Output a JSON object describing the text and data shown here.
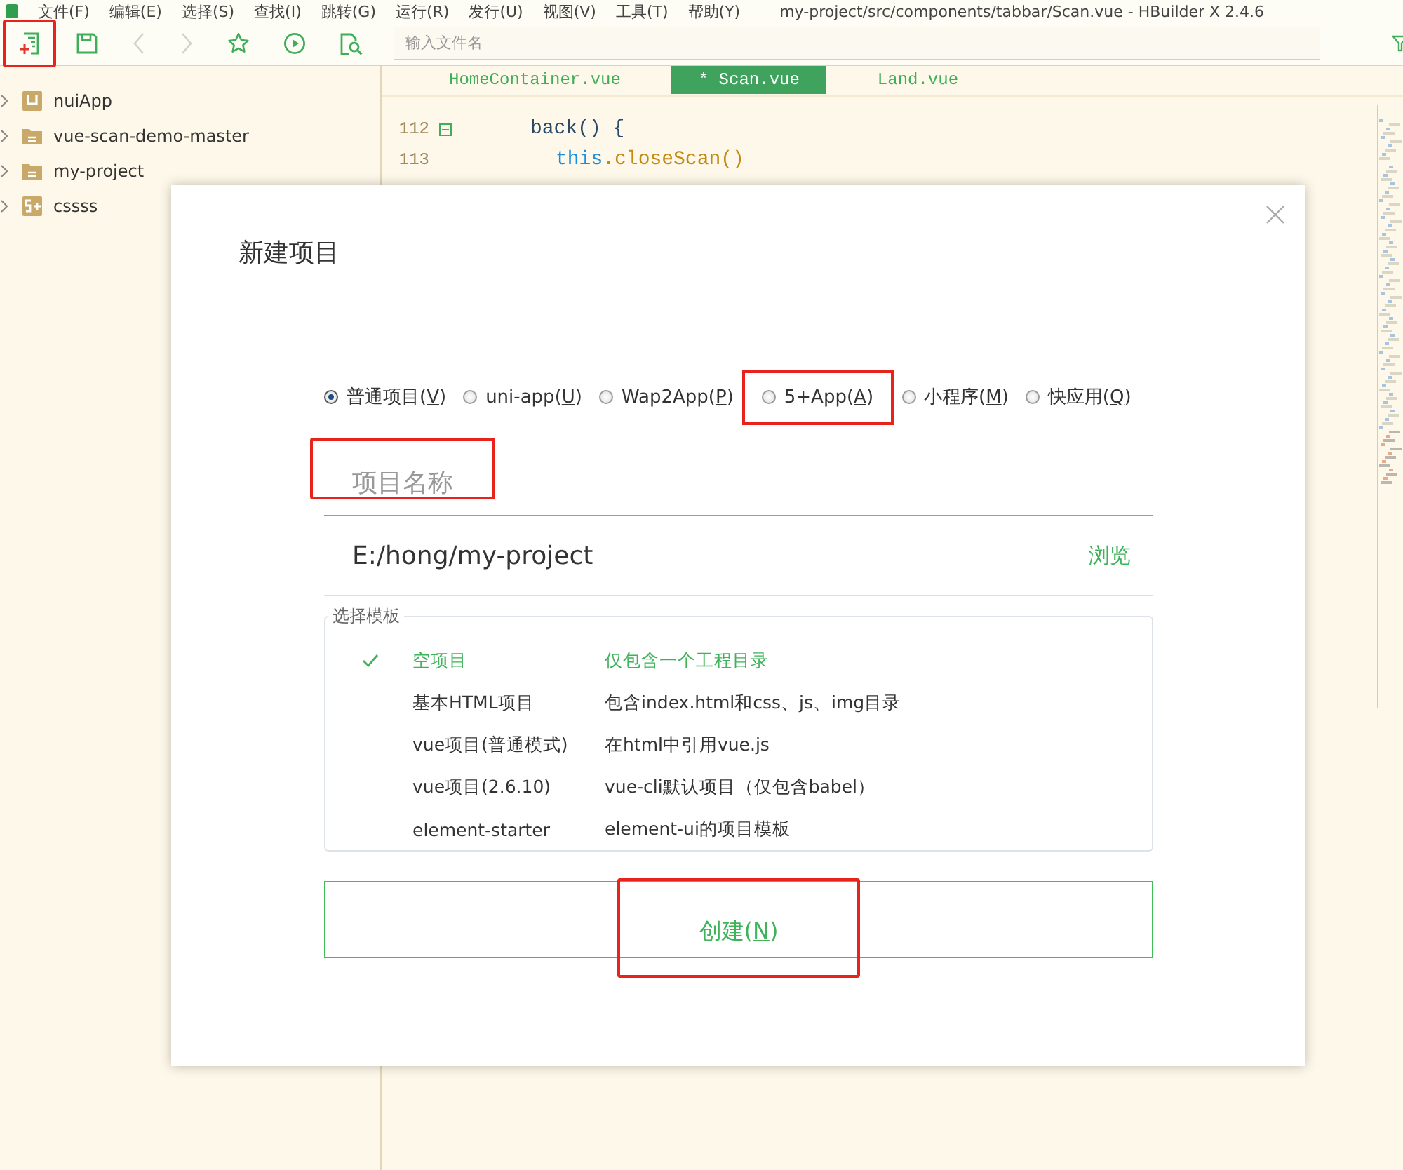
{
  "menu": [
    "文件(F)",
    "编辑(E)",
    "选择(S)",
    "查找(I)",
    "跳转(G)",
    "运行(R)",
    "发行(U)",
    "视图(V)",
    "工具(T)",
    "帮助(Y)"
  ],
  "window": {
    "title": "my-project/src/components/tabbar/Scan.vue - HBuilder X 2.4.6"
  },
  "toolbar": {
    "buttons": [
      {
        "kind": "new-file",
        "disabled": false,
        "highlighted": true
      },
      {
        "kind": "save",
        "disabled": false,
        "highlighted": false
      },
      {
        "kind": "back",
        "disabled": true,
        "highlighted": false
      },
      {
        "kind": "forward",
        "disabled": true,
        "highlighted": false
      },
      {
        "kind": "star",
        "disabled": false,
        "highlighted": false
      },
      {
        "kind": "run",
        "disabled": false,
        "highlighted": false
      },
      {
        "kind": "file-search",
        "disabled": false,
        "highlighted": false
      }
    ],
    "search": {
      "placeholder": "输入文件名"
    }
  },
  "sidebar": {
    "items": [
      {
        "label": "nuiApp",
        "kind": "uni"
      },
      {
        "label": "vue-scan-demo-master",
        "kind": "folder"
      },
      {
        "label": "my-project",
        "kind": "folder"
      },
      {
        "label": "cssss",
        "kind": "plus5"
      }
    ]
  },
  "editor": {
    "tabs": [
      {
        "label": "HomeContainer.vue",
        "selected": false
      },
      {
        "label": "* Scan.vue",
        "selected": true
      },
      {
        "label": "Land.vue",
        "selected": false
      }
    ],
    "lines": [
      {
        "number": "112",
        "foldable": true,
        "tokens": [
          {
            "text": "back() {",
            "kind": "plain"
          }
        ]
      },
      {
        "number": "113",
        "foldable": false,
        "tokens": [
          {
            "text": "this",
            "kind": "keyword"
          },
          {
            "text": ".closeScan()",
            "kind": "call"
          }
        ]
      }
    ]
  },
  "dialog": {
    "title": "新建项目",
    "project_types": [
      {
        "prefix": "普通项目(",
        "mnemonic": "V",
        "suffix": ")",
        "selected": true,
        "highlighted": false
      },
      {
        "prefix": "uni-app(",
        "mnemonic": "U",
        "suffix": ")",
        "selected": false,
        "highlighted": false
      },
      {
        "prefix": "Wap2App(",
        "mnemonic": "P",
        "suffix": ")",
        "selected": false,
        "highlighted": false
      },
      {
        "prefix": "5+App(",
        "mnemonic": "A",
        "suffix": ")",
        "selected": false,
        "highlighted": true
      },
      {
        "prefix": "小程序(",
        "mnemonic": "M",
        "suffix": ")",
        "selected": false,
        "highlighted": false
      },
      {
        "prefix": "快应用(",
        "mnemonic": "Q",
        "suffix": ")",
        "selected": false,
        "highlighted": false
      }
    ],
    "name_field": {
      "placeholder": "项目名称",
      "highlighted": true
    },
    "path": {
      "value": "E:/hong/my-project",
      "browse": "浏览"
    },
    "templates": {
      "legend": "选择模板",
      "items": [
        {
          "name": "空项目",
          "description": "仅包含一个工程目录",
          "selected": true
        },
        {
          "name": "基本HTML项目",
          "description": "包含index.html和css、js、img目录",
          "selected": false
        },
        {
          "name": "vue项目(普通模式)",
          "description": "在html中引用vue.js",
          "selected": false
        },
        {
          "name": "vue项目(2.6.10)",
          "description": "vue-cli默认项目（仅包含babel）",
          "selected": false
        },
        {
          "name": "element-starter",
          "description": "element-ui的项目模板",
          "selected": false
        }
      ]
    },
    "create_button": {
      "prefix": "创建(",
      "mnemonic": "N",
      "suffix": ")",
      "highlighted": true
    }
  }
}
